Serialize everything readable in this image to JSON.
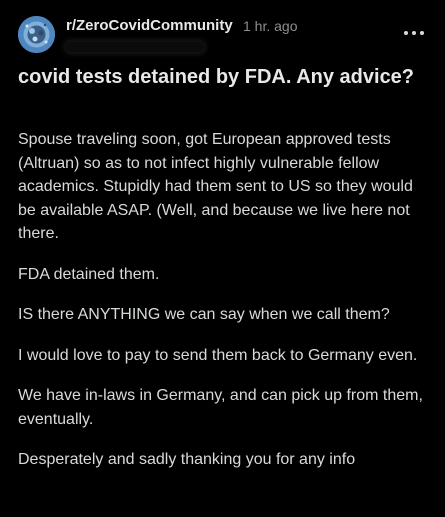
{
  "post": {
    "subreddit": "r/ZeroCovidCommunity",
    "time": "1 hr. ago",
    "title": "covid tests detained by FDA. Any advice?",
    "paragraphs": [
      "Spouse traveling soon, got European approved tests (Altruan) so as to not infect highly vulnerable fellow academics. Stupidly had them sent to US so they would be available ASAP. (Well, and because we live here not there.",
      "FDA detained them.",
      "IS there ANYTHING we can say when we call them?",
      "I would love to pay to send them back to Germany even.",
      "We have in-laws in Germany, and can pick up from them, eventually.",
      "Desperately and sadly thanking you for any info"
    ]
  },
  "icons": {
    "avatar": "subreddit-avatar-icon",
    "more": "more-options-icon"
  },
  "colors": {
    "background": "#000000",
    "text": "#d7dadc",
    "muted": "#8b8e90"
  }
}
